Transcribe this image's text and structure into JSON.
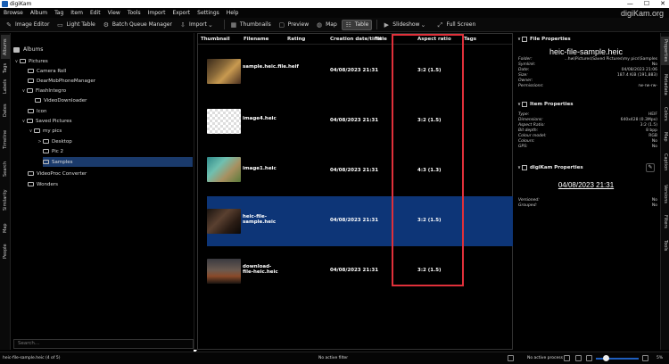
{
  "window": {
    "title": "digiKam",
    "controls": [
      "—",
      "☐",
      "✕"
    ]
  },
  "brand": "digiKam.org",
  "menu": [
    "Browse",
    "Album",
    "Tag",
    "Item",
    "Edit",
    "View",
    "Tools",
    "Import",
    "Export",
    "Settings",
    "Help"
  ],
  "toolbar": {
    "image_editor": "Image Editor",
    "light_table": "Light Table",
    "batch_queue": "Batch Queue Manager",
    "import": "Import",
    "thumbnails": "Thumbnails",
    "preview": "Preview",
    "map": "Map",
    "table": "Table",
    "slideshow": "Slideshow",
    "full_screen": "Full Screen"
  },
  "left_tabs": [
    "Albums",
    "Tags",
    "Labels",
    "Dates",
    "Timeline",
    "Search",
    "Similarity",
    "Map",
    "People"
  ],
  "right_tabs": [
    "Properties",
    "Metadata",
    "Colors",
    "Map",
    "Caption",
    "Versions",
    "Filters",
    "Tools"
  ],
  "albums": {
    "title": "Albums",
    "search_placeholder": "Search...",
    "tree": [
      {
        "label": "Pictures",
        "chev": "∨"
      },
      {
        "label": "Camera Roll",
        "chev": ""
      },
      {
        "label": "DearMobPhoneManager",
        "chev": ""
      },
      {
        "label": "FlashIntegro",
        "chev": "∨"
      },
      {
        "label": "VideoDownloader",
        "chev": ""
      },
      {
        "label": "Icon",
        "chev": ""
      },
      {
        "label": "Saved Pictures",
        "chev": "∨"
      },
      {
        "label": "my pics",
        "chev": "∨"
      },
      {
        "label": "Desktop",
        "chev": ">"
      },
      {
        "label": "Pic 2",
        "chev": ""
      },
      {
        "label": "Samples",
        "chev": ""
      },
      {
        "label": "VideoProc Converter",
        "chev": ""
      },
      {
        "label": "Wonders",
        "chev": ""
      }
    ]
  },
  "table": {
    "headers": [
      "Thumbnail",
      "Filename",
      "Rating",
      "Creation date/time",
      "Title",
      "Aspect ratio",
      "Tags"
    ],
    "rows": [
      {
        "filename": "sample.heic.file.heif",
        "date": "04/08/2023 21:31",
        "aspect": "3:2 (1.5)"
      },
      {
        "filename": "image4.heic",
        "date": "04/08/2023 21:31",
        "aspect": "3:2 (1.5)"
      },
      {
        "filename": "image1.heic",
        "date": "04/08/2023 21:31",
        "aspect": "4:3 (1.3)"
      },
      {
        "filename": "heic-file-sample.heic",
        "date": "04/08/2023 21:31",
        "aspect": "3:2 (1.5)"
      },
      {
        "filename": "download-file-heic.heic",
        "date": "04/08/2023 21:31",
        "aspect": "3:2 (1.5)"
      }
    ]
  },
  "properties": {
    "file_section": "File Properties",
    "filename": "heic-file-sample.heic",
    "file_rows": [
      {
        "k": "Folder:",
        "v": "...hw\\Pictures\\Saved Pictures\\my pics\\Samples"
      },
      {
        "k": "Symlink:",
        "v": "No"
      },
      {
        "k": "Date:",
        "v": "04/08/2023 21:06"
      },
      {
        "k": "Size:",
        "v": "187.4 KiB (191,883)"
      },
      {
        "k": "Owner:",
        "v": ""
      },
      {
        "k": "Permissions:",
        "v": "rw-rw-rw-"
      }
    ],
    "item_section": "Item Properties",
    "item_rows": [
      {
        "k": "Type:",
        "v": "HEIF"
      },
      {
        "k": "Dimensions:",
        "v": "640x428 (0.3Mpx)"
      },
      {
        "k": "Aspect Ratio:",
        "v": "3:2 (1.5)"
      },
      {
        "k": "Bit depth:",
        "v": "8 bpp"
      },
      {
        "k": "Colour model:",
        "v": "RGB"
      },
      {
        "k": "Colours:",
        "v": "No"
      },
      {
        "k": "GPS:",
        "v": "No"
      }
    ],
    "digikam_section": "digiKam Properties",
    "date_link": "04/08/2023 21:31",
    "dk_rows": [
      {
        "k": "Versioned:",
        "v": "No"
      },
      {
        "k": "Grouped:",
        "v": "No"
      }
    ]
  },
  "status": {
    "left": "heic-file-sample.heic (4 of 5)",
    "filter": "No active filter",
    "progress": "No active process",
    "zoom": "5%"
  }
}
